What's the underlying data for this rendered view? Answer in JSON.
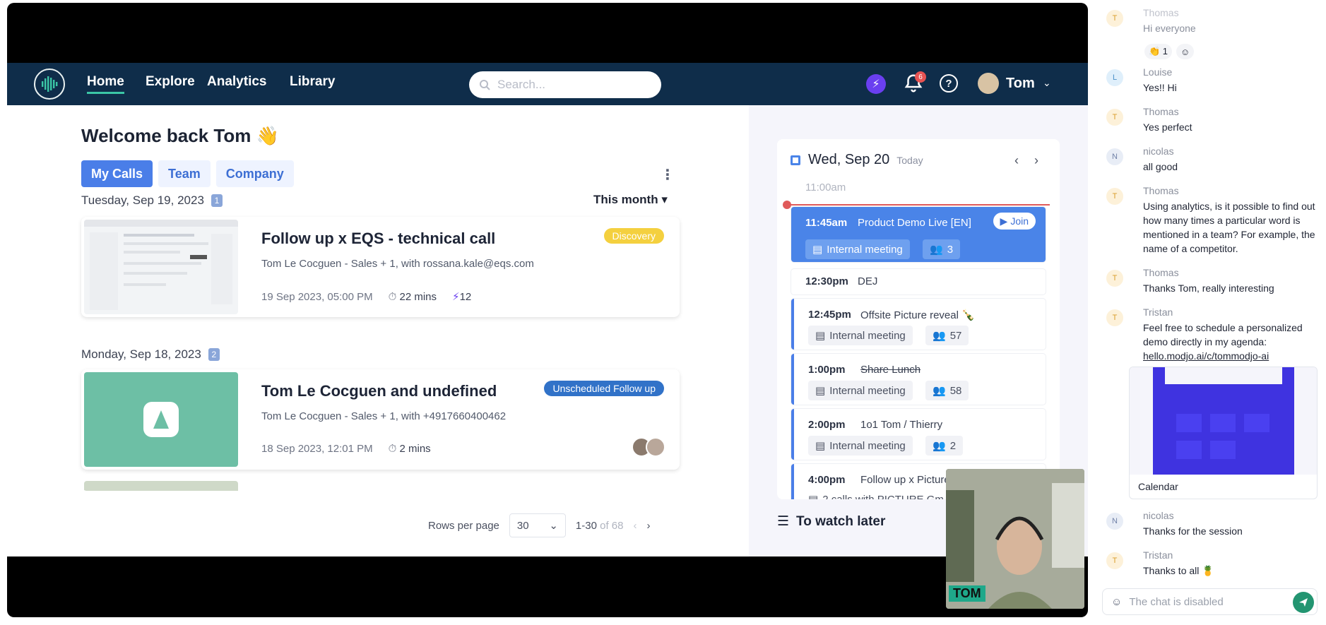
{
  "nav": {
    "links": [
      "Home",
      "Explore",
      "Analytics",
      "Library"
    ],
    "search_placeholder": "Search...",
    "notification_count": "6",
    "user_name": "Tom"
  },
  "main": {
    "welcome": "Welcome back Tom 👋",
    "tabs": [
      "My Calls",
      "Team",
      "Company"
    ],
    "filter": "This month",
    "groups": [
      {
        "date": "Tuesday, Sep 19, 2023",
        "count": "1",
        "calls": [
          {
            "title": "Follow up x EQS - technical call",
            "subtitle": "Tom Le Cocguen - Sales + 1, with rossana.kale@eqs.com",
            "datetime": "19 Sep 2023, 05:00 PM",
            "duration": "22 mins",
            "score": "12",
            "tag": "Discovery"
          }
        ]
      },
      {
        "date": "Monday, Sep 18, 2023",
        "count": "2",
        "calls": [
          {
            "title": "Tom Le Cocguen and undefined",
            "subtitle": "Tom Le Cocguen - Sales + 1, with +4917660400462",
            "datetime": "18 Sep 2023, 12:01 PM",
            "duration": "2 mins",
            "tag": "Unscheduled Follow up"
          }
        ]
      }
    ],
    "pager": {
      "rows_label": "Rows per page",
      "rows_value": "30",
      "range": "1-30",
      "total": "of 68"
    }
  },
  "calendar": {
    "date": "Wed, Sep 20",
    "today": "Today",
    "first_time": "11:00am",
    "join_label": "Join",
    "events": [
      {
        "time": "11:45am",
        "title": "Product Demo Live [EN]",
        "type": "Internal meeting",
        "people": "3"
      },
      {
        "time": "12:30pm",
        "title": "DEJ"
      },
      {
        "time": "12:45pm",
        "title": "Offsite Picture reveal 🍾",
        "type": "Internal meeting",
        "people": "57"
      },
      {
        "time": "1:00pm",
        "title": "Share Lunch",
        "type": "Internal meeting",
        "people": "58"
      },
      {
        "time": "2:00pm",
        "title": "1o1 Tom / Thierry",
        "type": "Internal meeting",
        "people": "2"
      },
      {
        "time": "4:00pm",
        "title": "Follow up x Picture",
        "type": "2 calls with PICTURE Gm"
      }
    ],
    "watch_later": "To watch later"
  },
  "camera": {
    "name": "TOM"
  },
  "chat": {
    "messages": [
      {
        "author": "Thomas",
        "initial": "T",
        "text": "Hi everyone",
        "reaction": "👏 1"
      },
      {
        "author": "Louise",
        "initial": "L",
        "text": "Yes!! Hi"
      },
      {
        "author": "Thomas",
        "initial": "T",
        "text": "Yes perfect"
      },
      {
        "author": "nicolas",
        "initial": "N",
        "text": "all good"
      },
      {
        "author": "Thomas",
        "initial": "T",
        "text": "Using analytics, is it possible to find out how many times a particular word is mentioned in a team? For example, the name of a competitor."
      },
      {
        "author": "Thomas",
        "initial": "T",
        "text": "Thanks Tom, really interesting"
      },
      {
        "author": "Tristan",
        "initial": "T",
        "text": "Feel free to schedule a personalized demo directly in my agenda:",
        "link": "hello.modjo.ai/c/tommodjo-ai"
      },
      {
        "author": "nicolas",
        "initial": "N",
        "text": "Thanks for the session"
      },
      {
        "author": "Tristan",
        "initial": "T",
        "text": "Thanks to all 🍍"
      }
    ],
    "link_preview_caption": "Calendar",
    "input_placeholder": "The chat is disabled"
  }
}
